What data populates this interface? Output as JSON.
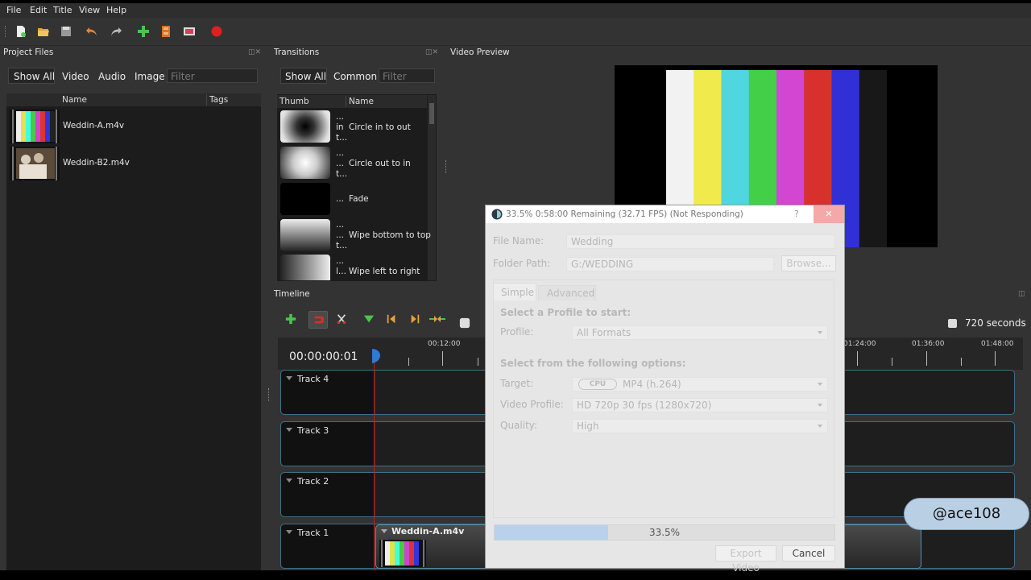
{
  "menu": [
    "File",
    "Edit",
    "Title",
    "View",
    "Help"
  ],
  "toolbar_icons": [
    "new-project-icon",
    "open-project-icon",
    "save-project-icon",
    "undo-icon",
    "redo-icon",
    "import-files-icon",
    "choose-profile-icon",
    "fullscreen-icon",
    "export-video-icon"
  ],
  "project_files": {
    "title": "Project Files",
    "filters": [
      "Show All",
      "Video",
      "Audio",
      "Image"
    ],
    "filter_placeholder": "Filter",
    "columns": [
      "Name",
      "Tags"
    ],
    "files": [
      {
        "name": "Weddin-A.m4v"
      },
      {
        "name": "Weddin-B2.m4v"
      }
    ]
  },
  "transitions": {
    "title": "Transitions",
    "filters": [
      "Show All",
      "Common"
    ],
    "filter_placeholder": "Filter",
    "columns": [
      "Thumb",
      "Name"
    ],
    "items": [
      {
        "prefix": "...\nin\nt...",
        "name": "Circle in to out"
      },
      {
        "prefix": "...\n...\nt...",
        "name": "Circle out to in"
      },
      {
        "prefix": "...",
        "name": "Fade"
      },
      {
        "prefix": "...\n...\nt...",
        "name": "Wipe bottom to top"
      },
      {
        "prefix": "...\nl...",
        "name": "Wipe left to right"
      }
    ]
  },
  "video_preview": {
    "title": "Video Preview",
    "bars": [
      "#f2f2f2",
      "#f0ea4c",
      "#4fd6df",
      "#44cf48",
      "#d246d1",
      "#d8302c",
      "#3030d6",
      "#181818"
    ]
  },
  "timeline": {
    "title": "Timeline",
    "timecode": "00:00:00:01",
    "zoom_label": "720 seconds",
    "ruler_labels": [
      "00:12:00",
      "01:24:00",
      "01:36:00",
      "01:48:00"
    ],
    "tracks": [
      "Track 4",
      "Track 3",
      "Track 2",
      "Track 1"
    ],
    "clip": {
      "name": "Weddin-A.m4v"
    }
  },
  "export_dialog": {
    "title": "33.5%  0:58:00 Remaining (32.71 FPS) (Not Responding)",
    "help": "?",
    "close": "✕",
    "file_name_label": "File Name:",
    "file_name": "Wedding",
    "folder_path_label": "Folder Path:",
    "folder_path": "G:/WEDDING",
    "browse": "Browse...",
    "tabs": [
      "Simple",
      "Advanced"
    ],
    "profile_heading": "Select a Profile to start:",
    "profile_label": "Profile:",
    "profile_value": "All Formats",
    "options_heading": "Select from the following options:",
    "target_label": "Target:",
    "target_badge": "CPU",
    "target_value": "MP4 (h.264)",
    "video_profile_label": "Video Profile:",
    "video_profile_value": "HD 720p 30 fps (1280x720)",
    "quality_label": "Quality:",
    "quality_value": "High",
    "progress_text": "33.5%",
    "progress_fraction": 0.335,
    "export_button": "Export Video",
    "cancel_button": "Cancel"
  },
  "watermark": "@ace108"
}
